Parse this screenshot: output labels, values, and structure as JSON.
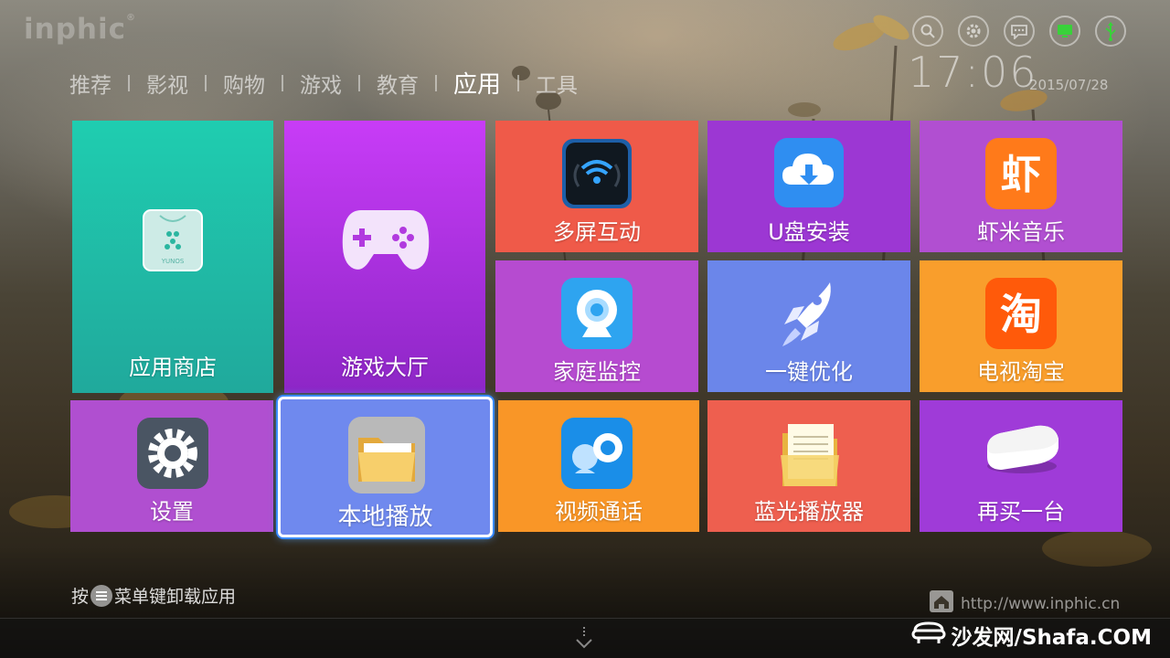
{
  "brand": {
    "logo_text": "inphic",
    "logo_mark": "®"
  },
  "nav": {
    "items": [
      {
        "label": "推荐",
        "active": false
      },
      {
        "label": "影视",
        "active": false
      },
      {
        "label": "购物",
        "active": false
      },
      {
        "label": "游戏",
        "active": false
      },
      {
        "label": "教育",
        "active": false
      },
      {
        "label": "应用",
        "active": true
      },
      {
        "label": "工具",
        "active": false
      }
    ]
  },
  "status": {
    "icons": [
      "search-icon",
      "gear-icon",
      "message-icon",
      "network-icon",
      "usb-icon"
    ],
    "time": "17:06",
    "date": "2015/07/28"
  },
  "tiles": {
    "appstore": {
      "label": "应用商店",
      "color": "#1fcdb0",
      "icon": "shopping-bag-icon",
      "icon_text": "YUNOS"
    },
    "gamehall": {
      "label": "游戏大厅",
      "color": "#c83cf7",
      "icon": "gamepad-icon"
    },
    "multiscreen": {
      "label": "多屏互动",
      "color": "#ef5a49",
      "icon": "wifi-screen-icon"
    },
    "usb": {
      "label": "U盘安装",
      "color": "#9c37d3",
      "icon": "cloud-download-icon"
    },
    "xiami": {
      "label": "虾米音乐",
      "color": "#b14fd1",
      "icon": "xiami-icon",
      "icon_text": "虾"
    },
    "monitor": {
      "label": "家庭监控",
      "color": "#b64bd0",
      "icon": "webcam-icon"
    },
    "optimize": {
      "label": "一键优化",
      "color": "#6b86ea",
      "icon": "rocket-icon"
    },
    "taobao": {
      "label": "电视淘宝",
      "color": "#f99e2c",
      "icon": "taobao-icon",
      "icon_text": "淘"
    },
    "settings": {
      "label": "设置",
      "color": "#b04fd0",
      "icon": "gear-icon"
    },
    "local": {
      "label": "本地播放",
      "color": "#6f89ee",
      "icon": "folder-icon",
      "focused": true
    },
    "videocall": {
      "label": "视频通话",
      "color": "#f99627",
      "icon": "video-call-icon"
    },
    "bluray": {
      "label": "蓝光播放器",
      "color": "#ee5f4f",
      "icon": "document-icon"
    },
    "buyone": {
      "label": "再买一台",
      "color": "#9f3bd8",
      "icon": "tv-box-icon"
    }
  },
  "footer": {
    "hint_prefix": "按",
    "hint_suffix": "菜单键卸载应用",
    "url": "http://www.inphic.cn",
    "watermark": "沙发网/Shafa.COM"
  }
}
